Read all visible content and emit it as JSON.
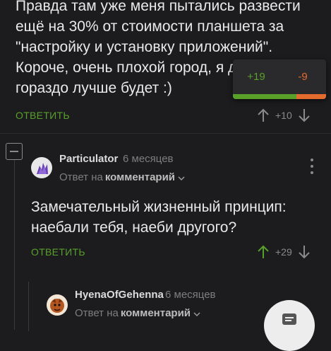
{
  "comment1": {
    "lines": [
      "Правда там уже меня пытались развести",
      "ещё на 30% от стоимости планшета за",
      "\"настройку и установку приложений\".",
      "Короче, очень плохой город, я д",
      "гораздо лучше будет :)"
    ],
    "reply_label": "ОТВЕТИТЬ",
    "rating": "+10"
  },
  "vote_popup": {
    "plus": "+19",
    "minus": "-9",
    "plus_fraction": 0.68
  },
  "comment2": {
    "username": "Particulator",
    "time": "6 месяцев",
    "reply_prefix": "Ответ на",
    "reply_target": "комментарий",
    "lines": [
      "Замечательный жизненный принцип:",
      "наебали тебя, наеби другого?"
    ],
    "reply_label": "ОТВЕТИТЬ",
    "rating": "+29"
  },
  "comment3": {
    "username": "HyenaOfGehenna",
    "time": "6 месяцев",
    "reply_prefix": "Ответ на",
    "reply_target": "комментарий"
  },
  "colors": {
    "background": "#1c1c1e",
    "accent_green": "#59a02b",
    "accent_orange": "#e36b2e"
  },
  "icons": [
    "arrow-up-icon",
    "arrow-down-icon",
    "collapse-minus-icon",
    "chevron-down-icon",
    "more-vertical-icon",
    "comments-fab-icon"
  ]
}
